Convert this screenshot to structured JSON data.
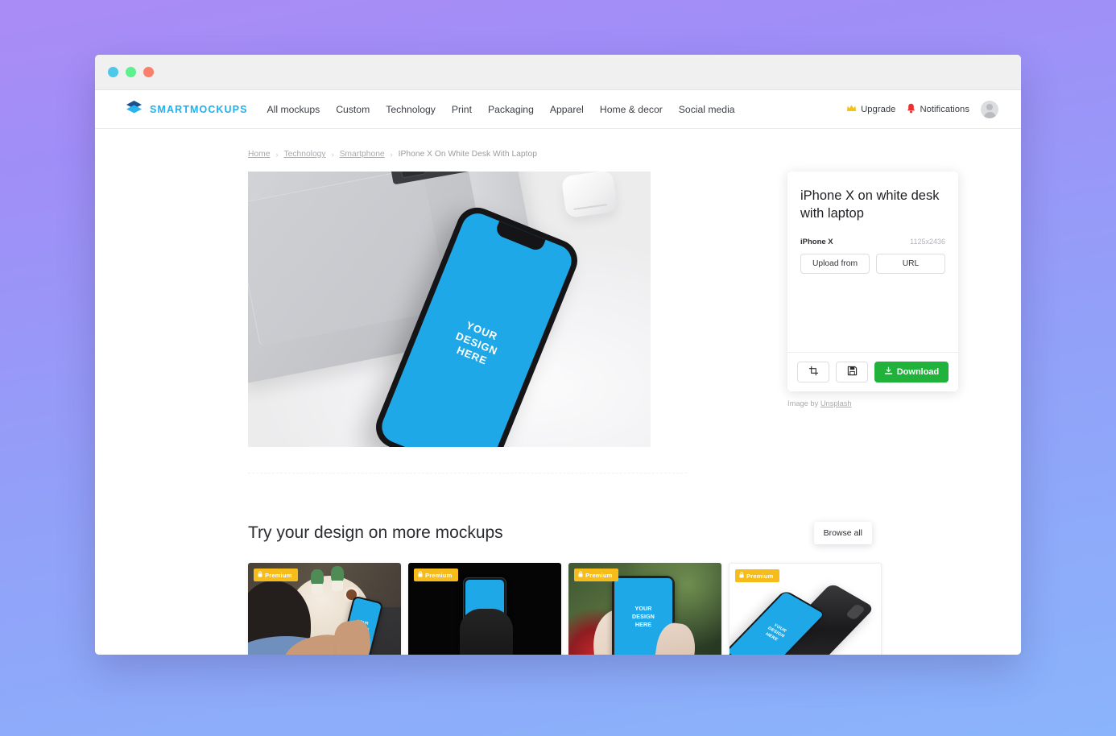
{
  "window": {
    "traffic_lights": [
      {
        "name": "close",
        "color": "#4ec8e8"
      },
      {
        "name": "minimize",
        "color": "#5cf08f"
      },
      {
        "name": "zoom",
        "color": "#fc7f6b"
      }
    ]
  },
  "nav": {
    "brand": "SMARTMOCKUPS",
    "brand_color": "#1eb0ef",
    "links": [
      "All mockups",
      "Custom",
      "Technology",
      "Print",
      "Packaging",
      "Apparel",
      "Home & decor",
      "Social media"
    ],
    "upgrade_label": "Upgrade",
    "notifications_label": "Notifications"
  },
  "breadcrumb": {
    "items": [
      "Home",
      "Technology",
      "Smartphone"
    ],
    "current": "IPhone X On White Desk With Laptop",
    "separator": "›"
  },
  "mockup": {
    "design_text": "YOUR\nDESIGN\nHERE",
    "design_line1": "YOUR",
    "design_line2": "DESIGN",
    "design_line3": "HERE",
    "screen_color": "#1fa8e8"
  },
  "panel": {
    "title": "iPhone X on white desk with laptop",
    "device": "iPhone X",
    "dimensions": "1125x2436",
    "upload_label": "Upload from",
    "url_label": "URL",
    "crop_icon": "crop-icon",
    "save_icon": "save-icon",
    "download_label": "Download",
    "download_color": "#21b23c",
    "credit_prefix": "Image by",
    "credit_source": "Unsplash"
  },
  "more": {
    "title": "Try your design on more mockups",
    "browse_all_label": "Browse all",
    "premium_label": "Premium",
    "premium_color": "#f5bc1c",
    "thumbnails": [
      {
        "name": "woman-holding-phone-cafe",
        "premium": "Premium"
      },
      {
        "name": "phone-in-hand-black-background",
        "premium": "Premium"
      },
      {
        "name": "phone-in-hand-outdoors",
        "premium": "Premium"
      },
      {
        "name": "two-phones-white-background",
        "premium": "Premium"
      }
    ]
  }
}
